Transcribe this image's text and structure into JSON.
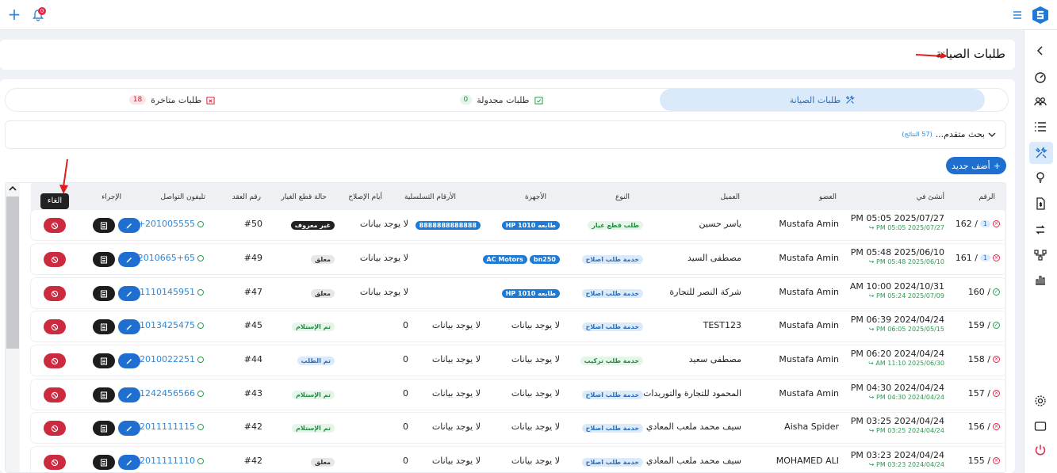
{
  "topbar": {
    "notification_count": "0"
  },
  "header": {
    "title": "طلبات الصيانة"
  },
  "tabs": [
    {
      "label": "طلبات الصيانة",
      "count": ""
    },
    {
      "label": "طلبات مجدولة",
      "count": "0"
    },
    {
      "label": "طلبات متاخرة",
      "count": "18"
    }
  ],
  "search": {
    "label": "بحث متقدم...",
    "results": "(57 النتائج)"
  },
  "add_button": {
    "label": "أضف جديد"
  },
  "tooltip": {
    "text": "الغاء"
  },
  "colors": {
    "accent": "#1f6fd0",
    "cancel": "#cc2a3f",
    "success": "#2a9d4e"
  },
  "table": {
    "headers": [
      "الرقم",
      "أنشئ في",
      "العضو",
      "العميل",
      "النوع",
      "الأجهزة",
      "الأرقام التسلسلية",
      "أيام الإصلاح",
      "حالة قطع الغيار",
      "رقم العقد",
      "تليفون التواصل",
      "الإجراء"
    ],
    "rows": [
      {
        "num": "162 /",
        "idx": "1",
        "status": "red",
        "created": "PM 05:05 2025/07/27",
        "updated": "↪ PM 05:05 2025/07/27",
        "member": "Mustafa Amin",
        "client": "ياسر حسين",
        "type": "طلب قطع غيار",
        "type_style": "green",
        "devices": [
          "طابعه HP 1010"
        ],
        "serial": "8888888888888",
        "days": "لا يوجد بيانات",
        "parts": "غير معروف",
        "parts_style": "dark",
        "contract": "#50",
        "phone": "+201005555"
      },
      {
        "num": "161 /",
        "idx": "1",
        "status": "red",
        "created": "PM 05:48 2025/06/10",
        "updated": "↪ PM 05:48 2025/06/10",
        "member": "Mustafa Amin",
        "client": "مصطفى السيد",
        "type": "خدمة طلب اصلاح",
        "type_style": "blue",
        "devices": [
          "bn250",
          "AC Motors"
        ],
        "serial": "",
        "days": "لا يوجد بيانات",
        "parts": "معلق",
        "parts_style": "gray",
        "contract": "#49",
        "phone": "+2010665+65"
      },
      {
        "num": "160 /",
        "idx": "",
        "status": "green",
        "created": "AM 10:00 2024/10/31",
        "updated": "↪ PM 05:24 2025/07/09",
        "member": "Mustafa Amin",
        "client": "شركة النصر للتجارة",
        "type": "خدمة طلب اصلاح",
        "type_style": "blue",
        "devices": [
          "طابعه HP 1010"
        ],
        "serial": "",
        "days": "لا يوجد بيانات",
        "parts": "معلق",
        "parts_style": "gray",
        "contract": "#47",
        "phone": "+201110145951"
      },
      {
        "num": "159 /",
        "idx": "",
        "status": "green",
        "created": "PM 06:39 2024/04/24",
        "updated": "↪ PM 06:05 2025/05/15",
        "member": "Mustafa Amin",
        "client": "TEST123",
        "type": "خدمة طلب اصلاح",
        "type_style": "blue",
        "devices_text": "لا يوجد بيانات",
        "serial_text": "لا يوجد بيانات",
        "days": "0",
        "parts": "تم الإستلام",
        "parts_style": "green",
        "contract": "#45",
        "phone": "+201013425475"
      },
      {
        "num": "158 /",
        "idx": "",
        "status": "red",
        "created": "PM 06:20 2024/04/24",
        "updated": "↪ AM 11:10 2025/06/30",
        "member": "Mustafa Amin",
        "client": "مصطفى سعيد",
        "type": "خدمة طلب تركيب",
        "type_style": "green",
        "devices_text": "لا يوجد بيانات",
        "serial_text": "لا يوجد بيانات",
        "days": "0",
        "parts": "تم الطلب",
        "parts_style": "blue",
        "contract": "#44",
        "phone": "+2010022251"
      },
      {
        "num": "157 /",
        "idx": "",
        "status": "red",
        "created": "PM 04:30 2024/04/24",
        "updated": "↪ PM 04:30 2024/04/24",
        "member": "Mustafa Amin",
        "client": "المحمود للتجارة والتوريدات",
        "type": "خدمة طلب اصلاح",
        "type_style": "blue",
        "devices_text": "لا يوجد بيانات",
        "serial_text": "لا يوجد بيانات",
        "days": "0",
        "parts": "تم الإستلام",
        "parts_style": "green",
        "contract": "#43",
        "phone": "+201242456566"
      },
      {
        "num": "156 /",
        "idx": "",
        "status": "red",
        "created": "PM 03:25 2024/04/24",
        "updated": "↪ PM 03:25 2024/04/24",
        "member": "Aisha Spider",
        "client": "سيف محمد ملعب المعادي",
        "type": "خدمة طلب اصلاح",
        "type_style": "blue",
        "devices_text": "لا يوجد بيانات",
        "serial_text": "لا يوجد بيانات",
        "days": "0",
        "parts": "تم الإستلام",
        "parts_style": "green",
        "contract": "#42",
        "phone": "+2011111115"
      },
      {
        "num": "155 /",
        "idx": "",
        "status": "red",
        "created": "PM 03:23 2024/04/24",
        "updated": "↪ PM 03:23 2024/04/24",
        "member": "MOHAMED ALI",
        "client": "سيف محمد ملعب المعادي",
        "type": "خدمة طلب اصلاح",
        "type_style": "blue",
        "devices_text": "لا يوجد بيانات",
        "serial_text": "لا يوجد بيانات",
        "days": "0",
        "parts": "معلق",
        "parts_style": "gray",
        "contract": "#42",
        "phone": "+2011111110"
      }
    ]
  }
}
